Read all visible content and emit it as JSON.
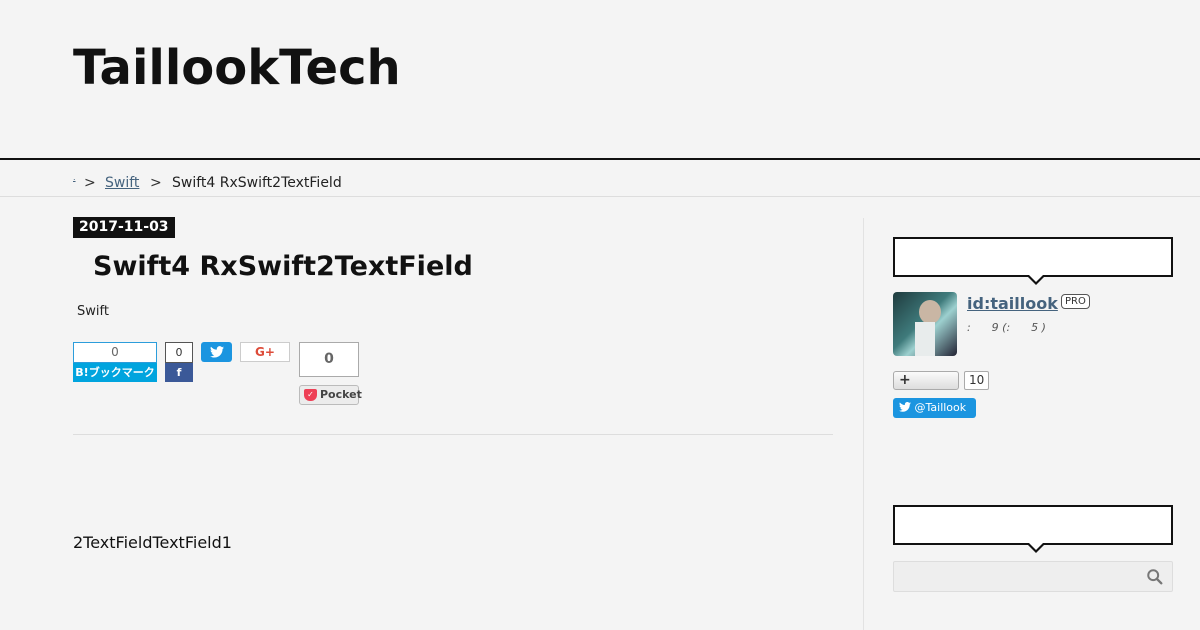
{
  "header": {
    "title": "TaillookTech"
  },
  "breadcrumb": {
    "home": ".",
    "separator": ">",
    "category": "Swift",
    "current": "Swift4 RxSwift2TextField"
  },
  "entry": {
    "date": "2017-11-03",
    "title": "Swift4 RxSwift2TextField",
    "category": "Swift",
    "body": "2TextFieldTextField1"
  },
  "share": {
    "hatena_count": "0",
    "hatena_label": "B!ブックマーク",
    "facebook_count": "0",
    "facebook_label": "f",
    "twitter_icon": "twitter-bird-icon",
    "gplus_label": "G+",
    "pocket_count": "0",
    "pocket_label": "Pocket"
  },
  "sidebar": {
    "profile": {
      "id": "id:taillook",
      "badge": "PRO",
      "meta": ":      9 (:      5 )",
      "follow_label": "+",
      "follow_count": "10",
      "twitter_follow": "@Taillook"
    },
    "search": {
      "placeholder": ""
    }
  },
  "colors": {
    "link": "#45637e",
    "hatena": "#00a4de",
    "facebook": "#3b5998",
    "twitter": "#1b95e0",
    "pocket": "#ee4056"
  }
}
